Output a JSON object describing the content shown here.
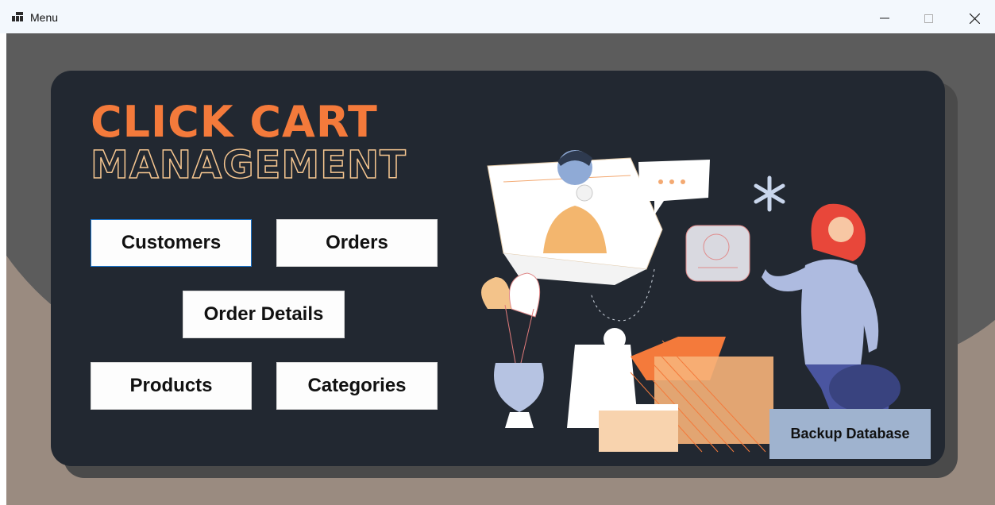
{
  "window": {
    "title": "Menu"
  },
  "brand": {
    "line1": "CLICK CART",
    "line2": "MANAGEMENT"
  },
  "buttons": {
    "customers": "Customers",
    "orders": "Orders",
    "order_details": "Order Details",
    "products": "Products",
    "categories": "Categories",
    "backup": "Backup Database"
  },
  "colors": {
    "accent_orange": "#f47a3b",
    "card_bg": "#222831",
    "backup_button": "#9fb3cf",
    "focus_border": "#1a73c9"
  },
  "icons": [
    "app-icon",
    "minimize-icon",
    "maximize-icon",
    "close-icon"
  ]
}
